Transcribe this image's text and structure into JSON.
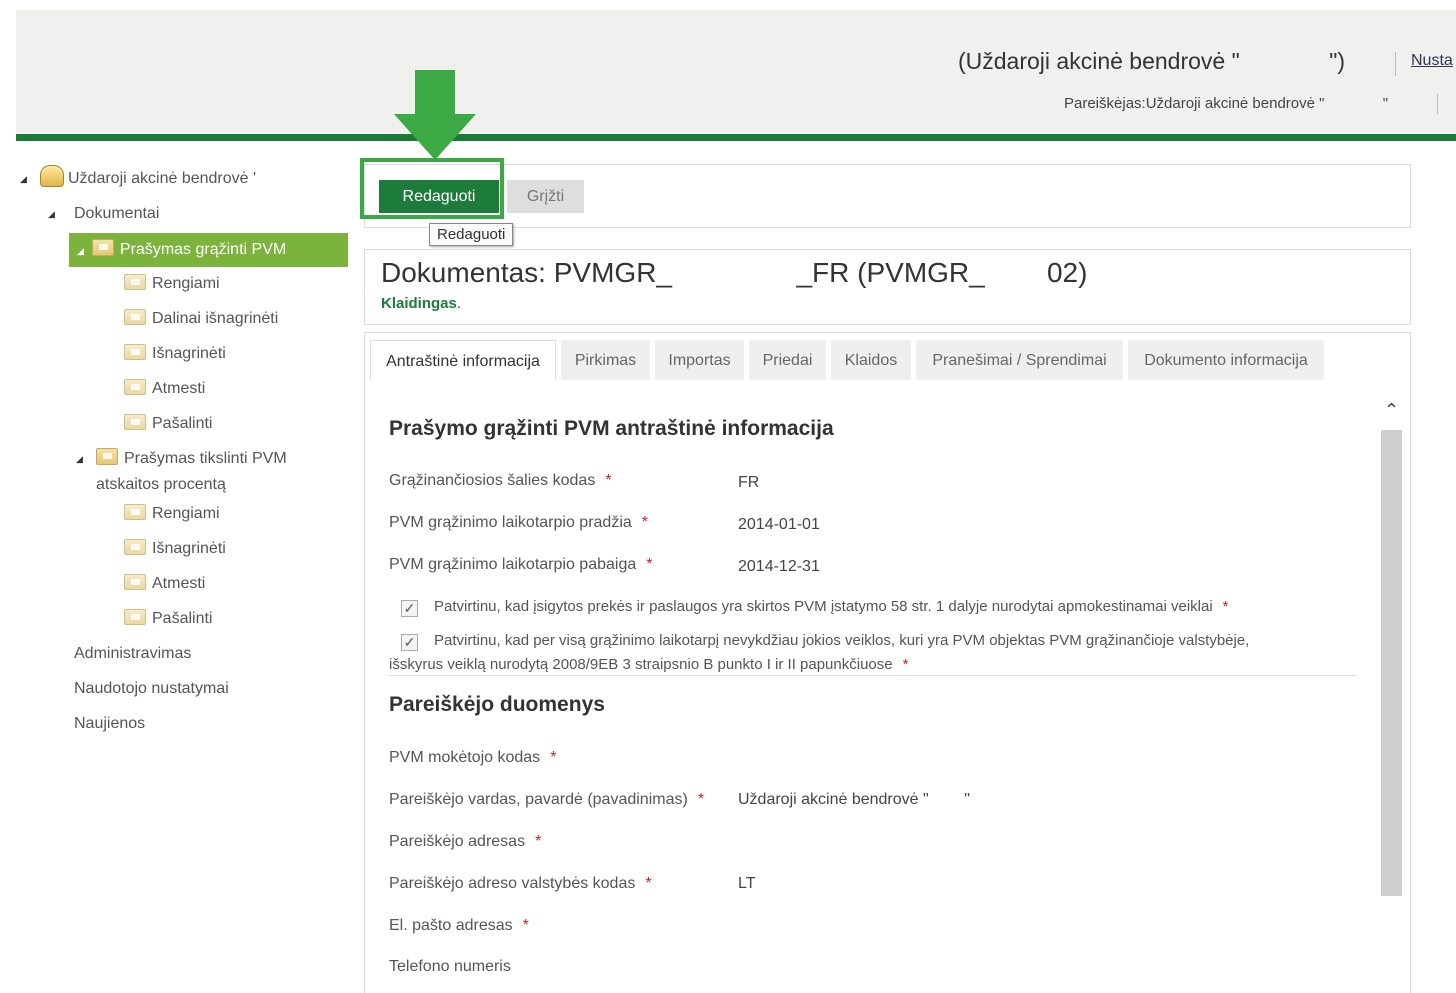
{
  "header": {
    "org_title": "(Uždaroji akcinė bendrovė \"              \")",
    "settings_link": "Nusta",
    "applicant": "Pareiškėjas:Uždaroji akcinė bendrovė \"              \""
  },
  "tree": {
    "root": "Uždaroji akcinė bendrovė '",
    "dokumentai": "Dokumentai",
    "group1": {
      "label": "Prašymas grąžinti PVM",
      "items": [
        "Rengiami",
        "Dalinai išnagrinėti",
        "Išnagrinėti",
        "Atmesti",
        "Pašalinti"
      ]
    },
    "group2": {
      "label_line1": "Prašymas tikslinti PVM",
      "label_line2": "atskaitos procentą",
      "items": [
        "Rengiami",
        "Išnagrinėti",
        "Atmesti",
        "Pašalinti"
      ]
    },
    "administravimas": "Administravimas",
    "naudotojo": "Naudotojo nustatymai",
    "naujienos": "Naujienos"
  },
  "toolbar": {
    "edit_label": "Redaguoti",
    "back_label": "Grįžti",
    "tooltip": "Redaguoti"
  },
  "document": {
    "title": "Dokumentas: PVMGR_                _FR (PVMGR_        02)",
    "status": "Klaidingas",
    "status_suffix": "."
  },
  "tabs": [
    "Antraštinė informacija",
    "Pirkimas",
    "Importas",
    "Priedai",
    "Klaidos",
    "Pranešimai / Sprendimai",
    "Dokumento informacija"
  ],
  "section1": {
    "title": "Prašymo grąžinti PVM antraštinė informacija",
    "fields": [
      {
        "label": "Grąžinančiosios šalies kodas",
        "value": "FR"
      },
      {
        "label": "PVM grąžinimo laikotarpio pradžia",
        "value": "2014-01-01"
      },
      {
        "label": "PVM grąžinimo laikotarpio pabaiga",
        "value": "2014-12-31"
      }
    ],
    "required_mark": "*",
    "check1": "Patvirtinu, kad įsigytos prekės ir paslaugos yra skirtos PVM įstatymo 58 str. 1 dalyje nurodytai apmokestinamai veiklai",
    "check2_line1": "Patvirtinu, kad per visą grąžinimo laikotarpį nevykdžiau jokios veiklos, kuri yra PVM objektas PVM grąžinančioje valstybėje,",
    "check2_line2": "išskyrus veiklą nurodytą 2008/9EB 3 straipsnio B punkto I ir II papunkčiuose",
    "check_mark": "✓"
  },
  "section2": {
    "title": "Pareiškėjo duomenys",
    "fields": [
      {
        "label": "PVM mokėtojo kodas",
        "value": ""
      },
      {
        "label": "Pareiškėjo vardas, pavardė (pavadinimas)",
        "value": "Uždaroji akcinė bendrovė \"        \""
      },
      {
        "label": "Pareiškėjo adresas",
        "value": ""
      },
      {
        "label": "Pareiškėjo adreso valstybės kodas",
        "value": "LT"
      },
      {
        "label": "El. pašto adresas",
        "value": ""
      },
      {
        "label": "Telefono numeris",
        "value": ""
      }
    ]
  },
  "scroll": {
    "up_glyph": "⌃"
  }
}
